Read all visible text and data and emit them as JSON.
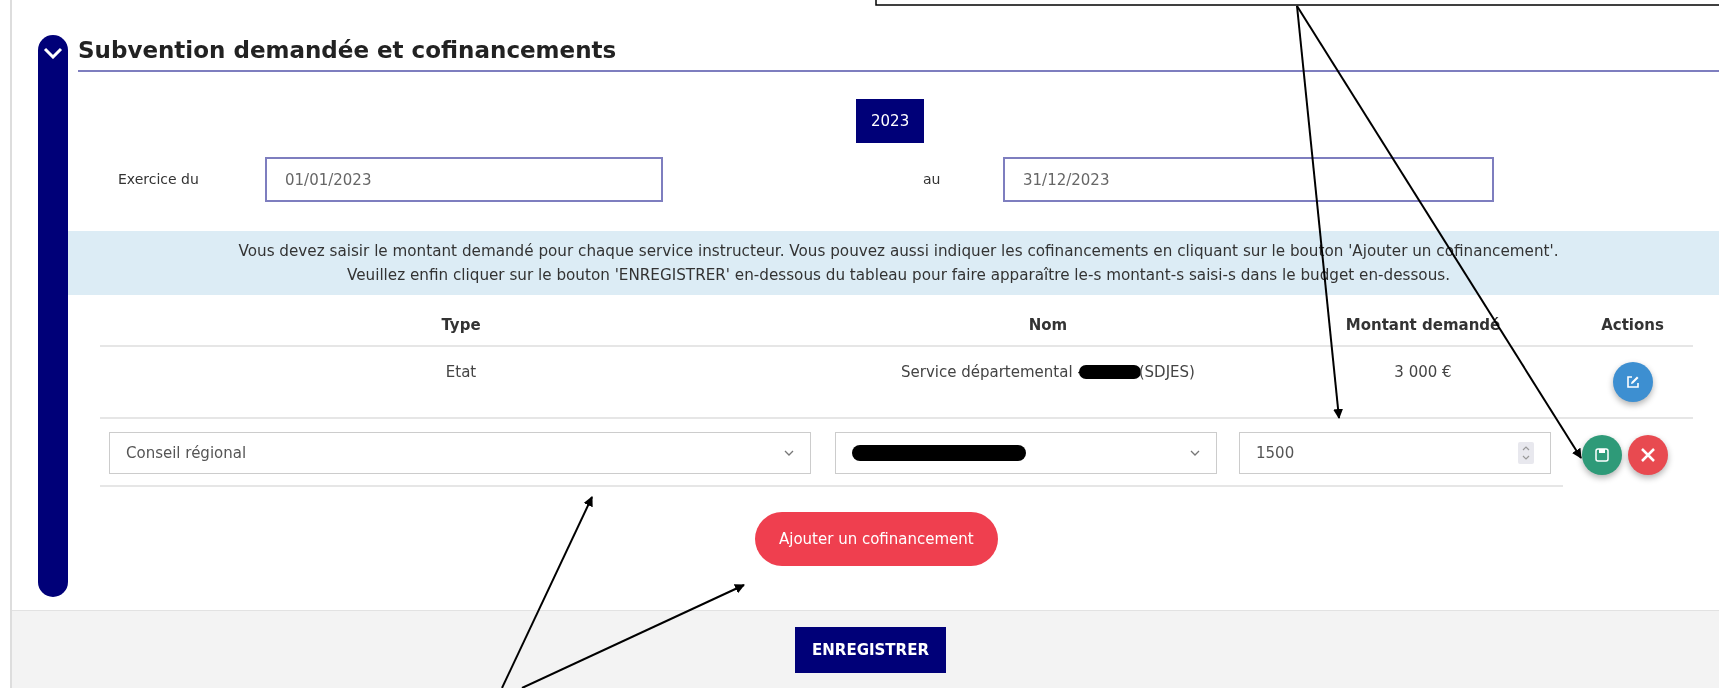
{
  "section": {
    "title": "Subvention demandée et cofinancements",
    "expanded": true
  },
  "year_tab": "2023",
  "period": {
    "from_label": "Exercice du",
    "from_value": "01/01/2023",
    "to_label": "au",
    "to_value": "31/12/2023"
  },
  "info_lines": [
    "Vous devez saisir le montant demandé pour chaque service instructeur. Vous pouvez aussi indiquer les cofinancements en cliquant sur le bouton 'Ajouter un cofinancement'.",
    "Veuillez enfin cliquer sur le bouton 'ENREGISTRER' en-dessous du tableau pour faire apparaître le-s montant-s saisi-s dans le budget en-dessous."
  ],
  "table": {
    "columns": [
      "Type",
      "Nom",
      "Montant demandé",
      "Actions"
    ],
    "rows": [
      {
        "type": "Etat",
        "name_before": "Service départemental -",
        "name_after": "(SDJES)",
        "amount": "3 000 €"
      }
    ],
    "edit_row": {
      "type_value": "Conseil régional",
      "amount_value": "1500"
    }
  },
  "add_button": "Ajouter un cofinancement",
  "save_button": "ENREGISTRER"
}
